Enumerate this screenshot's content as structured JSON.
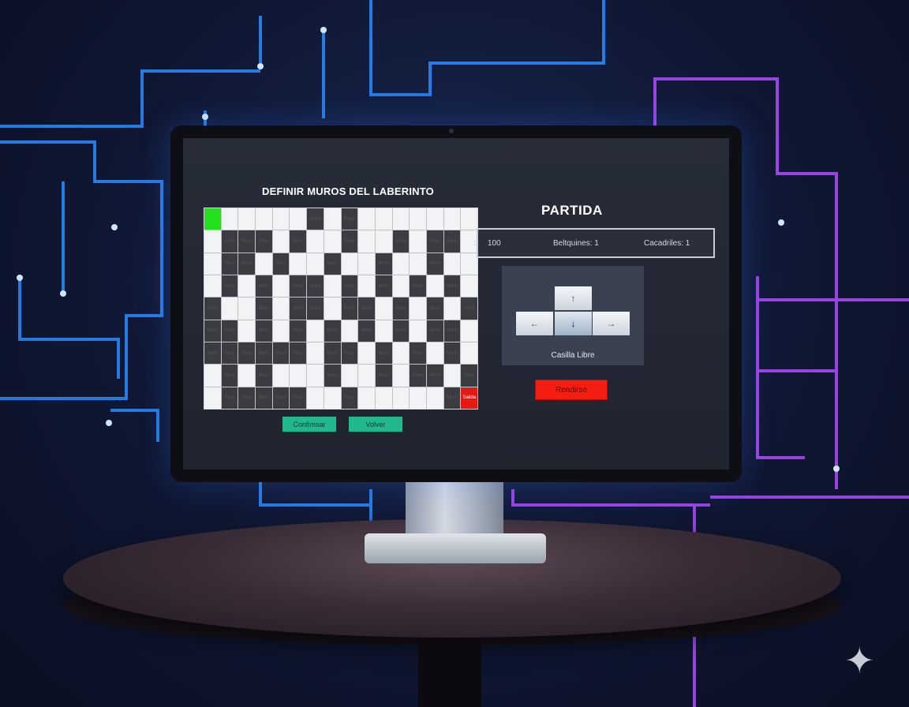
{
  "editor": {
    "title": "DEFINIR MUROS DEL LABERINTO",
    "rows": [
      "S.....#.#.......",
      ".###.#..#..#.##.",
      ".##.#..#..#..#..",
      ".#.#.##.#.#.#.#.",
      "#..#.##.##.#.#.#",
      "##.#.#.#.#.#.##.",
      "######.##.#.#.#.",
      ".#.#...#..#.##.#",
      ".#####..#.....#E"
    ],
    "wall_text": "Muro",
    "exit_text": "Salida",
    "confirm_label": "Confimsar",
    "back_label": "Volver"
  },
  "game": {
    "title": "PARTIDA",
    "status": {
      "score": "100",
      "score_prefix": "≥",
      "boots": "Beltquines: 1",
      "crocodiles": "Cacadriles: 1"
    },
    "controls": {
      "up": "↑",
      "left": "←",
      "down": "↓",
      "right": "→",
      "selected": "down"
    },
    "cell_status": "Casilla Libre",
    "surrender_label": "Rendirse"
  },
  "colors": {
    "start": "#22e01c",
    "exit": "#e41a12",
    "wall": "#3a3c41",
    "accent_button": "#20b98e",
    "surrender": "#f41f12"
  }
}
